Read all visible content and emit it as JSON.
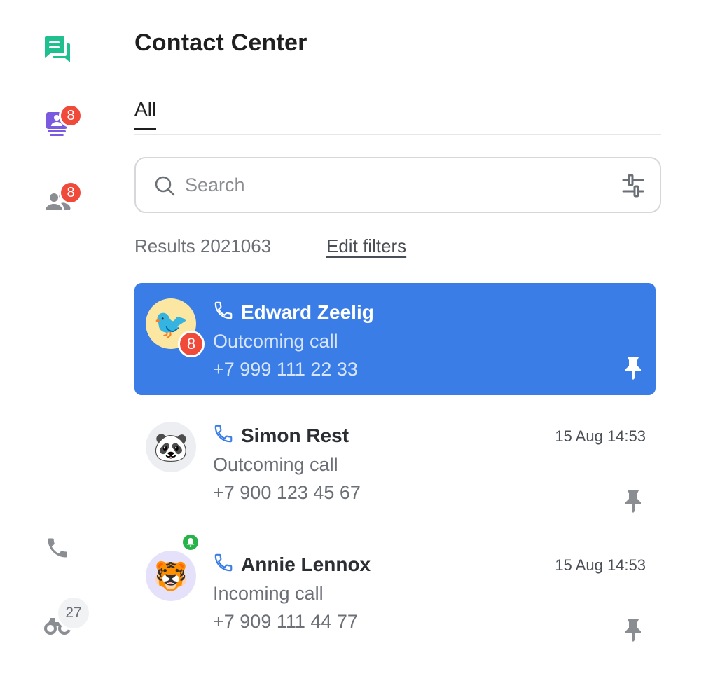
{
  "colors": {
    "accent": "#3a7de6",
    "badge_red": "#f04a3a",
    "online_green": "#27b34a",
    "chat_green": "#1fbf8f",
    "queue_purple": "#7a5be0",
    "icon_grey": "#8a8d92"
  },
  "rail": {
    "items": [
      {
        "icon": "chat-icon",
        "badge": null
      },
      {
        "icon": "queue-icon",
        "badge": "8"
      },
      {
        "icon": "contacts-icon",
        "badge": "8"
      },
      {
        "icon": "phone-icon",
        "badge": null
      },
      {
        "icon": "binoculars-icon",
        "badge": "27"
      }
    ]
  },
  "header": {
    "title": "Contact Center"
  },
  "tabs": [
    {
      "label": "All",
      "active": true
    }
  ],
  "search": {
    "placeholder": "Search",
    "value": ""
  },
  "results": {
    "label": "Results 2021063",
    "edit_filters": "Edit filters"
  },
  "contacts": [
    {
      "name": "Edward Zeelig",
      "call_type": "Outcoming call",
      "phone": "+7 999 111 22 33",
      "time": "",
      "avatar": "🐦",
      "unread": "8",
      "active": true,
      "pinned": true
    },
    {
      "name": "Simon Rest",
      "call_type": "Outcoming call",
      "phone": "+7 900 123 45 67",
      "time": "15 Aug 14:53",
      "avatar": "🐼",
      "unread": null,
      "active": false,
      "pinned": false
    },
    {
      "name": "Annie Lennox",
      "call_type": "Incoming call",
      "phone": "+7 909 111 44 77",
      "time": "15 Aug 14:53",
      "avatar": "🐯",
      "unread": null,
      "notification": true,
      "active": false,
      "pinned": false
    }
  ]
}
